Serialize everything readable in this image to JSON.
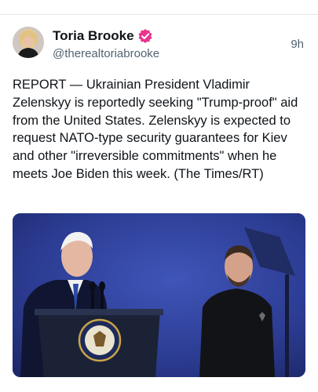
{
  "post": {
    "author": {
      "display_name": "Toria Brooke",
      "handle": "@therealtoriabrooke",
      "verified_icon": "verified-badge-icon",
      "verified_color": "#e8358f"
    },
    "timestamp": "9h",
    "text": "REPORT — Ukrainian President Vladimir Zelenskyy is reportedly seeking \"Trump-proof\" aid from the United States. Zelenskyy is expected to request NATO-type security guarantees for Kiev and other \"irreversible commitments\" when he meets Joe Biden this week. (The Times/RT)",
    "media": {
      "type": "photo",
      "background_color": "#2a3a8c"
    }
  }
}
